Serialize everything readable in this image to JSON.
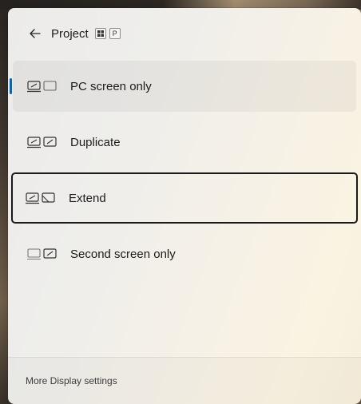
{
  "header": {
    "back_icon": "arrow-left-icon",
    "title": "Project",
    "shortcut_keys": [
      "windows-logo-icon",
      "P"
    ]
  },
  "options": [
    {
      "label": "PC screen only",
      "icon": "pc-screen-only-icon",
      "selected": true
    },
    {
      "label": "Duplicate",
      "icon": "duplicate-icon",
      "selected": false
    },
    {
      "label": "Extend",
      "icon": "extend-icon",
      "selected": false,
      "focused": true
    },
    {
      "label": "Second screen only",
      "icon": "second-screen-only-icon",
      "selected": false
    }
  ],
  "footer": {
    "link_label": "More Display settings"
  },
  "colors": {
    "accent": "#0067c0",
    "text": "#1b1b1b"
  }
}
